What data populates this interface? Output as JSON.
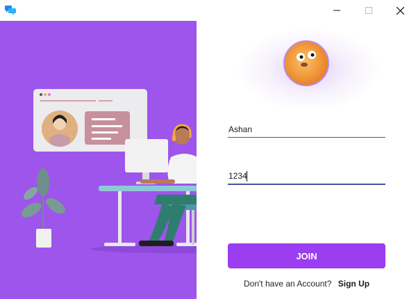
{
  "window": {
    "icons": {
      "app": "chat-bubbles-icon",
      "minimize": "minimize-icon",
      "maximize": "maximize-icon",
      "close": "close-icon"
    }
  },
  "colors": {
    "panel_purple": "#9d55ec",
    "button_purple": "#9b3df0",
    "underline_user": "#7a3aa6",
    "underline_pass": "#4a4fa8"
  },
  "login": {
    "username_value": "Ashan",
    "password_value": "1234",
    "join_label": "JOIN",
    "signup_prompt": "Don't have an Account?",
    "signup_link": "Sign Up"
  }
}
